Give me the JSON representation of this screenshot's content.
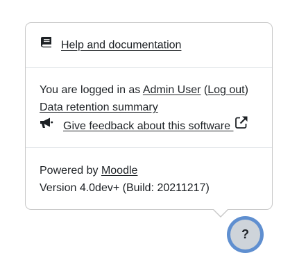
{
  "popover": {
    "help": {
      "icon": "book-icon",
      "label": "Help and documentation"
    },
    "login": {
      "prefix": "You are logged in as ",
      "user": "Admin User",
      "open_paren": " (",
      "logout": "Log out",
      "close_paren": ")"
    },
    "data_retention": "Data retention summary",
    "feedback": {
      "icon": "megaphone-icon",
      "label": "Give feedback about this software ",
      "external_icon": "external-link-icon"
    },
    "powered": {
      "prefix": "Powered by ",
      "link": "Moodle"
    },
    "version": "Version 4.0dev+ (Build: 20211217)"
  },
  "help_button": {
    "label": "?",
    "icon": "question-icon"
  },
  "colors": {
    "text": "#1d2125",
    "border": "#c8c8c8",
    "button_ring": "#5f8fd0",
    "button_fill": "#ced4da"
  }
}
